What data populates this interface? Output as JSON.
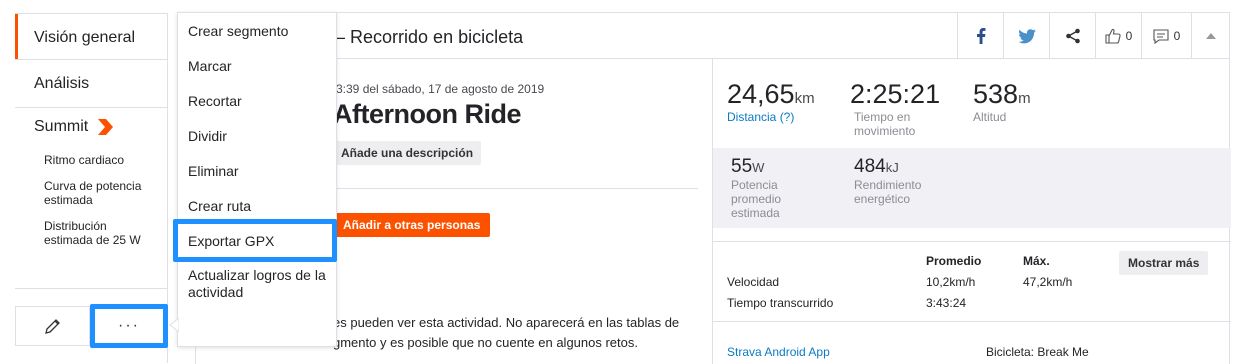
{
  "sidebar": {
    "items": [
      {
        "label": "Visión general"
      },
      {
        "label": "Análisis"
      }
    ],
    "summit": {
      "label": "Summit",
      "sub_items": [
        {
          "label": "Ritmo cardiaco"
        },
        {
          "label": "Curva de potencia estimada"
        },
        {
          "label": "Distribución estimada de 25 W"
        }
      ]
    },
    "more_label": "···"
  },
  "menu": {
    "items": [
      {
        "label": "Crear segmento"
      },
      {
        "label": "Marcar"
      },
      {
        "label": "Recortar"
      },
      {
        "label": "Dividir"
      },
      {
        "label": "Eliminar"
      },
      {
        "label": "Crear ruta"
      },
      {
        "label": "Exportar GPX"
      },
      {
        "label": "Actualizar logros de la actividad"
      }
    ]
  },
  "header": {
    "title": "ie – Recorrido en bicicleta",
    "like_count": "0",
    "comment_count": "0"
  },
  "activity": {
    "date": "3:39 del sábado, 17 de agosto de 2019",
    "title": "Afternoon Ride",
    "add_description": "Añade una descripción",
    "add_people": "Añadir a otras personas",
    "privacy_line1": "es pueden ver esta actividad. No aparecerá en las tablas de",
    "privacy_line2": "gmento y es posible que no cuente en algunos retos."
  },
  "stats": {
    "distance": {
      "value": "24,65",
      "unit": "km",
      "label": "Distancia (?)"
    },
    "moving_time": {
      "value": "2:25:21",
      "label": "Tiempo en movimiento"
    },
    "elevation": {
      "value": "538",
      "unit": "m",
      "label": "Altitud"
    },
    "power": {
      "value": "55",
      "unit": "W",
      "label": "Potencia promedio estimada"
    },
    "energy": {
      "value": "484",
      "unit": "kJ",
      "label": "Rendimiento energético"
    }
  },
  "table": {
    "headers": {
      "avg": "Promedio",
      "max": "Máx."
    },
    "rows": [
      {
        "label": "Velocidad",
        "avg": "10,2km/h",
        "max": "47,2km/h"
      },
      {
        "label": "Tiempo transcurrido",
        "avg": "3:43:24",
        "max": ""
      }
    ],
    "show_more": "Mostrar más"
  },
  "footer": {
    "app": "Strava Android App",
    "bike": "Bicicleta: Break Me"
  },
  "colors": {
    "accent": "#fc5200",
    "highlight": "#1e90ff",
    "link": "#0a7bc2"
  }
}
